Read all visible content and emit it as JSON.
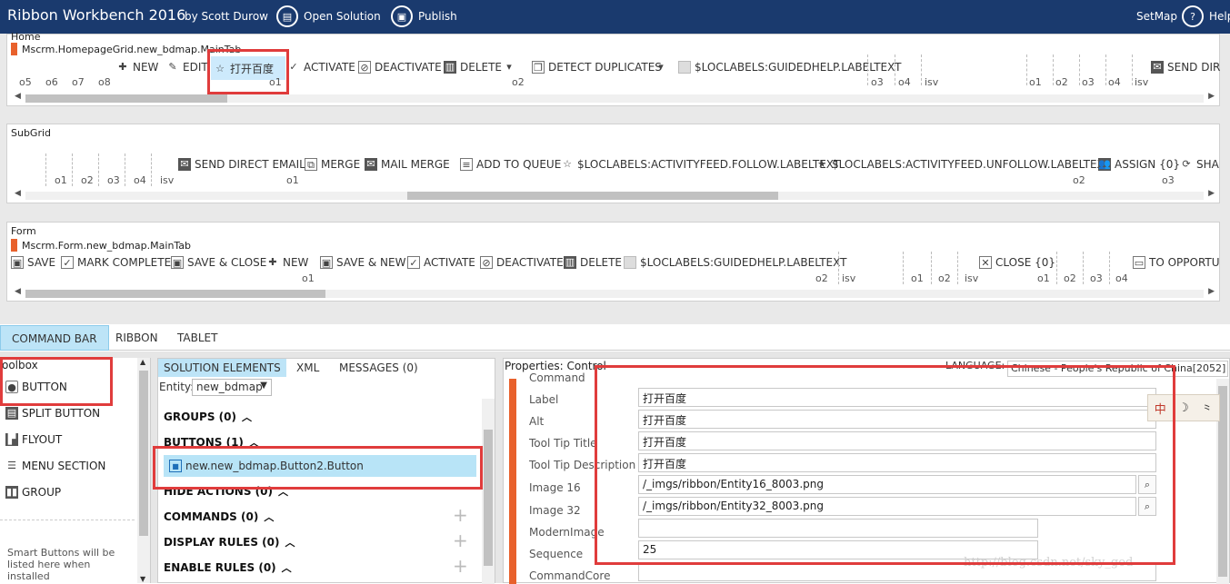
{
  "app": {
    "title": "Ribbon Workbench 2016",
    "author": "by Scott Durow",
    "open_solution": "Open Solution",
    "publish": "Publish",
    "setmap": "SetMap",
    "help": "Help"
  },
  "home_panel": {
    "label": "Home",
    "tab": "Mscrm.HomepageGrid.new_bdmap.MainTab",
    "buttons": {
      "new": "NEW",
      "edit": "EDIT",
      "custom": "打开百度",
      "activate": "ACTIVATE",
      "deactivate": "DEACTIVATE",
      "delete": "DELETE",
      "detect_duplicates": "DETECT DUPLICATES",
      "guidedhelp": "$LOCLABELS:GUIDEDHELP.LABELTEXT",
      "send_direct": "SEND DIR"
    },
    "groups": {
      "g1": "o5",
      "g2": "o6",
      "g3": "o7",
      "g4": "o8",
      "g5": "o1",
      "g6": "o2",
      "g7": "o3",
      "g8": "o4",
      "g9": "isv",
      "g10": "o1",
      "g11": "o2",
      "g12": "o3",
      "g13": "o4",
      "g14": "isv"
    }
  },
  "subgrid_panel": {
    "label": "SubGrid",
    "buttons": {
      "send_email": "SEND DIRECT EMAIL",
      "merge": "MERGE",
      "mail_merge": "MAIL MERGE",
      "add_queue": "ADD TO QUEUE",
      "follow": "$LOCLABELS:ACTIVITYFEED.FOLLOW.LABELTEXT",
      "unfollow": "$LOCLABELS:ACTIVITYFEED.UNFOLLOW.LABELTEXT",
      "assign": "ASSIGN {0}",
      "share": "SHA"
    },
    "groups": {
      "g1": "o1",
      "g2": "o2",
      "g3": "o3",
      "g4": "o4",
      "g5": "isv",
      "g6": "o1",
      "g7": "o2",
      "g8": "o3"
    }
  },
  "form_panel": {
    "label": "Form",
    "tab": "Mscrm.Form.new_bdmap.MainTab",
    "buttons": {
      "save": "SAVE",
      "mark_complete": "MARK COMPLETE",
      "save_close": "SAVE & CLOSE",
      "new": "NEW",
      "save_new": "SAVE & NEW",
      "activate": "ACTIVATE",
      "deactivate": "DEACTIVATE",
      "delete": "DELETE",
      "guidedhelp": "$LOCLABELS:GUIDEDHELP.LABELTEXT",
      "close": "CLOSE {0}",
      "to_opportunity": "TO OPPORTU"
    },
    "groups": {
      "g1": "o1",
      "g2": "o2",
      "g3": "isv",
      "g4": "o1",
      "g5": "o2",
      "g6": "isv",
      "g7": "o1",
      "g8": "o2",
      "g9": "o3",
      "g10": "o4"
    }
  },
  "main_tabs": {
    "command_bar": "COMMAND BAR",
    "ribbon": "RIBBON",
    "tablet": "TABLET"
  },
  "toolbox": {
    "title": "oolbox",
    "items": {
      "button": "BUTTON",
      "split_button": "SPLIT BUTTON",
      "flyout": "FLYOUT",
      "menu_section": "MENU SECTION",
      "group": "GROUP"
    },
    "hint_line1": "Smart Buttons will be",
    "hint_line2": "listed here when",
    "hint_line3": "installed"
  },
  "solution": {
    "tabs": {
      "elements": "SOLUTION ELEMENTS",
      "xml": "XML",
      "messages": "MESSAGES (0)"
    },
    "entity_label": "Entity:",
    "entity_value": "new_bdmap",
    "sections": {
      "groups": "GROUPS (0)",
      "buttons": "BUTTONS (1)",
      "hide_actions": "HIDE ACTIONS (0)",
      "commands": "COMMANDS (0)",
      "display_rules": "DISPLAY RULES (0)",
      "enable_rules": "ENABLE RULES (0)"
    },
    "button_item": "new.new_bdmap.Button2.Button"
  },
  "properties": {
    "title": "Properties: Control",
    "language_label": "LANGUAGE:",
    "language_value": "Chinese - People's Republic of China[2052]",
    "labels": {
      "command": "Command",
      "label": "Label",
      "alt": "Alt",
      "tooltip_title": "Tool Tip Title",
      "tooltip_desc": "Tool Tip Description",
      "image16": "Image 16",
      "image32": "Image 32",
      "modern_image": "ModernImage",
      "sequence": "Sequence",
      "command_core": "CommandCore"
    },
    "values": {
      "label": "打开百度",
      "alt": "打开百度",
      "tooltip_title": "打开百度",
      "tooltip_desc": "打开百度",
      "image16": "/_imgs/ribbon/Entity16_8003.png",
      "image32": "/_imgs/ribbon/Entity32_8003.png",
      "modern_image": "",
      "sequence": "25"
    }
  },
  "ime": {
    "c1": "中",
    "c2": "☽",
    "c3": "⺀"
  },
  "watermark": "http://blog.csdn.net/sky_god"
}
